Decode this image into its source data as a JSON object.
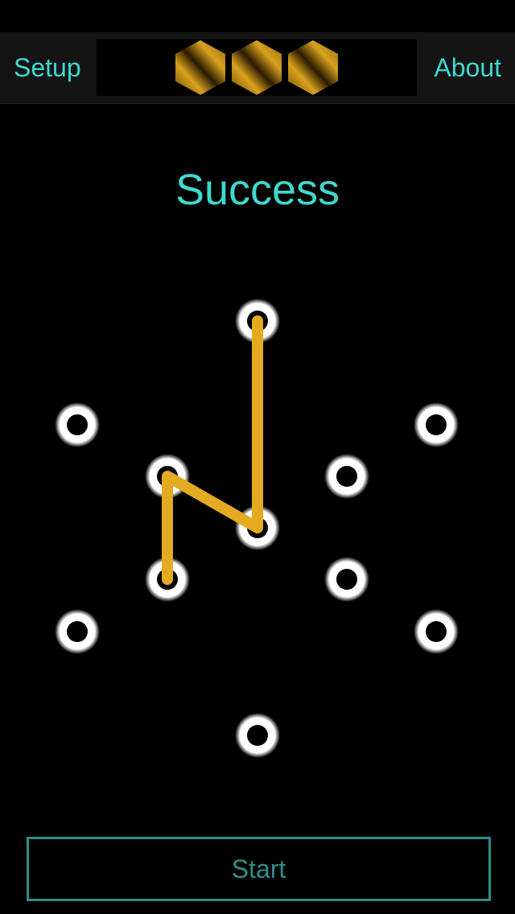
{
  "nav": {
    "left_label": "Setup",
    "right_label": "About",
    "attempts": [
      {
        "icon": "gold-hexagon-icon"
      },
      {
        "icon": "gold-hexagon-icon"
      },
      {
        "icon": "gold-hexagon-icon"
      }
    ]
  },
  "status": {
    "text": "Success"
  },
  "pattern": {
    "dot_count": 11,
    "path_dots": [
      1,
      4,
      3,
      5
    ],
    "colors": {
      "path": "#e4aa22",
      "dot_fill": "#000000",
      "dot_ring": "#ffffff"
    }
  },
  "start": {
    "label": "Start"
  },
  "colors": {
    "accent": "#3ed9cf",
    "start_border": "#2d8f8a",
    "gold": "#e4aa22"
  }
}
